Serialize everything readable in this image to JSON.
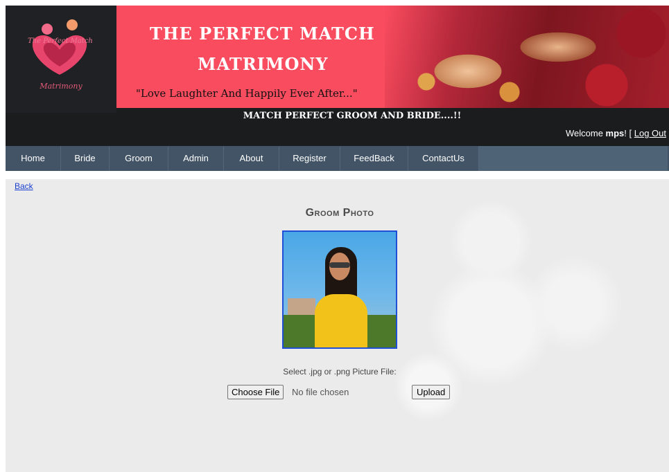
{
  "header": {
    "logo": {
      "arc_text": "The Perfect Match",
      "sub_text": "Matrimony"
    },
    "banner": {
      "title_line1": "THE PERFECT MATCH",
      "title_line2": "MATRIMONY",
      "quote": "\"Love Laughter  And Happily Ever After...\""
    },
    "tagline": "MATCH PERFECT GROOM AND BRIDE....!!",
    "welcome": {
      "prefix": "Welcome ",
      "username": "mps",
      "separator": "! [ ",
      "logout_label": "Log Out"
    }
  },
  "nav": {
    "items": [
      {
        "label": "Home"
      },
      {
        "label": "Bride"
      },
      {
        "label": "Groom"
      },
      {
        "label": "Admin"
      },
      {
        "label": "About"
      },
      {
        "label": "Register"
      },
      {
        "label": "FeedBack"
      },
      {
        "label": "ContactUs"
      }
    ]
  },
  "main": {
    "back_link": "Back",
    "heading": "Groom Photo",
    "select_label": "Select .jpg or .png Picture File:",
    "file_input": {
      "button_label": "Choose File",
      "status": "No file chosen"
    },
    "upload_label": "Upload"
  },
  "colors": {
    "header_bg": "#1b1c1e",
    "banner_red": "#fa4c5f",
    "nav_bg": "#425466",
    "link_blue": "#1a3fd0",
    "photo_border": "#1f4fd6"
  }
}
